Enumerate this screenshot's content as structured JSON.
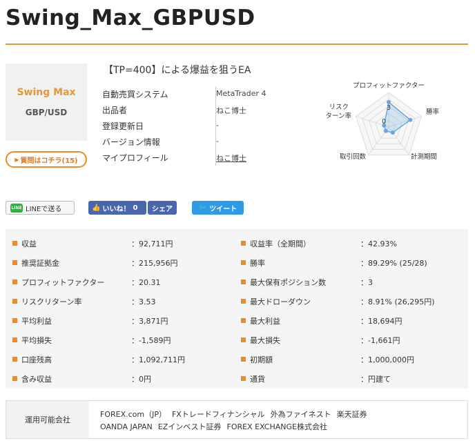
{
  "title": "Swing_Max_GBPUSD",
  "logo": {
    "line1": "Swing Max",
    "line2": "GBP/USD"
  },
  "question_button": "質問はコチラ(15)",
  "tagline": "【TP=400】による爆益を狙うEA",
  "info": [
    {
      "label": "自動売買システム",
      "value": "MetaTrader 4",
      "link": false
    },
    {
      "label": "出品者",
      "value": "ねこ博士",
      "link": false
    },
    {
      "label": "登録更新日",
      "value": "-",
      "link": false
    },
    {
      "label": "バージョン情報",
      "value": "-",
      "link": false
    },
    {
      "label": "マイプロフィール",
      "value": "ねこ博士",
      "link": true
    }
  ],
  "radar": {
    "axes": [
      "プロフィットファクター",
      "勝率",
      "計測期間",
      "取引回数",
      "リスク",
      "ターン率"
    ],
    "tick_labels": [
      "3",
      "0"
    ],
    "values": [
      3.6,
      3.3,
      1.0,
      0.7,
      0.7
    ],
    "max": 5,
    "color": "#6aa6e4"
  },
  "share": {
    "line_icon": "LINE",
    "line": "LINEで送る",
    "like": "いいね！",
    "like_count": "0",
    "fb_share": "シェア",
    "tweet": "ツイート"
  },
  "stats": [
    {
      "left_label": "収益",
      "left_value": "：92,711円",
      "right_label": "収益率（全期間）",
      "right_value": "：42.93%"
    },
    {
      "left_label": "推奨証拠金",
      "left_value": "：215,956円",
      "right_label": "勝率",
      "right_value": "：89.29% (25/28)"
    },
    {
      "left_label": "プロフィットファクター",
      "left_value": "：20.31",
      "right_label": "最大保有ポジション数",
      "right_value": "：3"
    },
    {
      "left_label": "リスクリターン率",
      "left_value": "：3.53",
      "right_label": "最大ドローダウン",
      "right_value": "：8.91% (26,295円)"
    },
    {
      "left_label": "平均利益",
      "left_value": "：3,871円",
      "right_label": "最大利益",
      "right_value": "：18,694円"
    },
    {
      "left_label": "平均損失",
      "left_value": "：-1,589円",
      "right_label": "最大損失",
      "right_value": "：-1,661円"
    },
    {
      "left_label": "口座残高",
      "left_value": "：1,092,711円",
      "right_label": "初期額",
      "right_value": "：1,000,000円"
    },
    {
      "left_label": "含み収益",
      "left_value": "：0円",
      "right_label": "通貨",
      "right_value": "：円建て"
    }
  ],
  "brokers": {
    "header": "運用可能会社",
    "line1": [
      "FOREX.com（JP）",
      "FXトレードフィナンシャル",
      "外為ファイネスト",
      "楽天証券"
    ],
    "line2": [
      "OANDA JAPAN",
      "EZインベスト証券",
      "FOREX EXCHANGE株式会社"
    ]
  },
  "colors": {
    "accent": "#f08a24",
    "facebook": "#4a66ad",
    "twitter": "#2f9ae6",
    "line": "#2cb13a"
  }
}
